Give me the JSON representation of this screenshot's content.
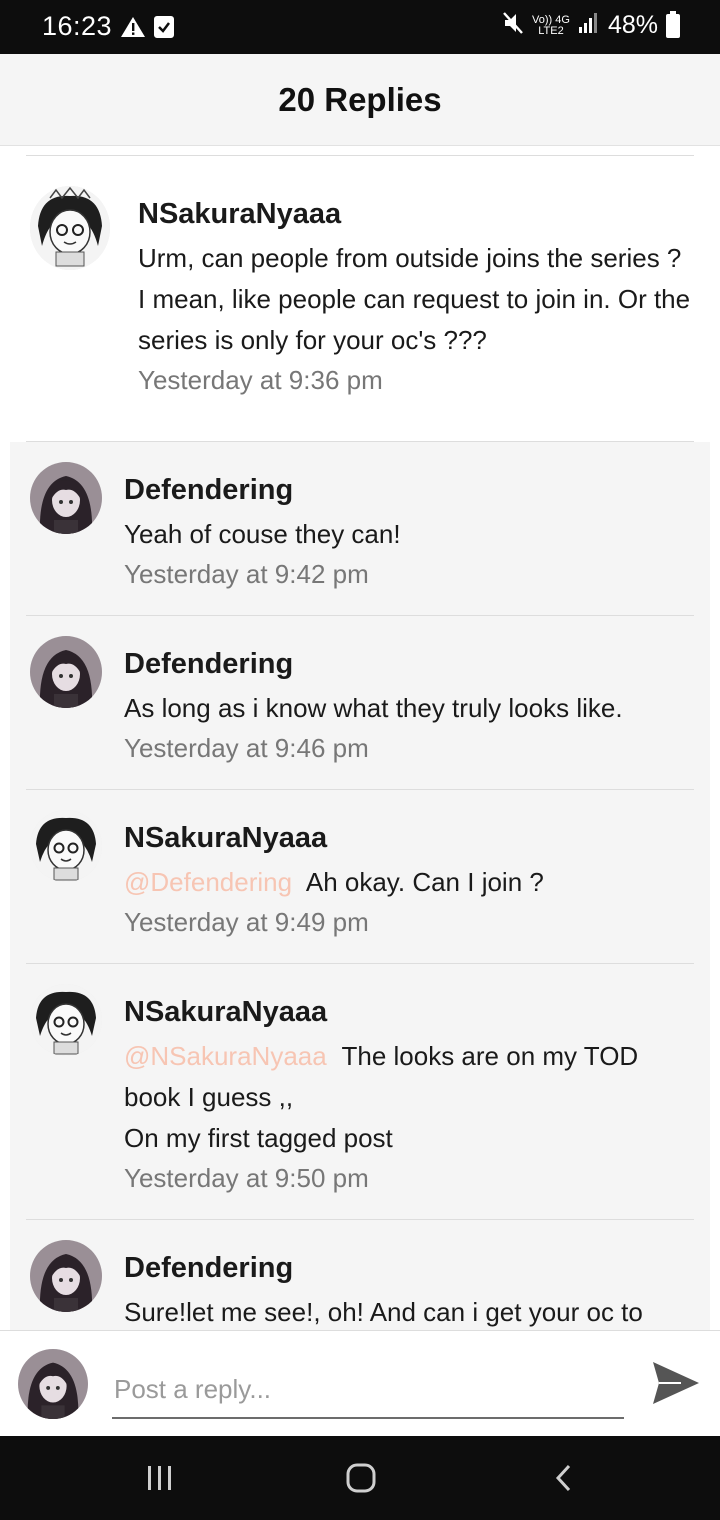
{
  "status_bar": {
    "time": "16:23",
    "network_top": "Vo)) 4G",
    "network_bottom": "LTE2",
    "battery": "48%"
  },
  "header": {
    "title": "20 Replies"
  },
  "top_comment": {
    "username": "NSakuraNyaaa",
    "text": "Urm, can people from outside joins the series ?  I mean, like people can request to join in. Or the series is only for your oc's ???",
    "time": "Yesterday at 9:36 pm"
  },
  "replies": [
    {
      "username": "Defendering",
      "mention": "",
      "text": "Yeah of couse they can!",
      "time": "Yesterday at 9:42 pm"
    },
    {
      "username": "Defendering",
      "mention": "",
      "text": "As long as i know what they truly looks like.",
      "time": "Yesterday at 9:46 pm"
    },
    {
      "username": "NSakuraNyaaa",
      "mention": "@Defendering",
      "text": "Ah okay. Can I join ?",
      "time": "Yesterday at 9:49 pm"
    },
    {
      "username": "NSakuraNyaaa",
      "mention": "@NSakuraNyaaa",
      "text": "The looks are on my TOD book I guess ,,",
      "text2": "On my first tagged post",
      "time": "Yesterday at 9:50 pm"
    },
    {
      "username": "Defendering",
      "mention": "",
      "text": "Sure!let me see!, oh! And can i get your oc to",
      "time": ""
    }
  ],
  "reply_bar": {
    "placeholder": "Post a reply..."
  },
  "colors": {
    "mention": "#f7c5b3",
    "header_bg": "#f5f5f5",
    "reply_bg": "#f5f5f5",
    "timestamp": "#777777"
  },
  "icons": [
    "warning-icon",
    "checkbox-icon",
    "mute-icon",
    "signal-icon",
    "battery-icon",
    "send-icon",
    "recents-icon",
    "home-icon",
    "back-icon"
  ]
}
